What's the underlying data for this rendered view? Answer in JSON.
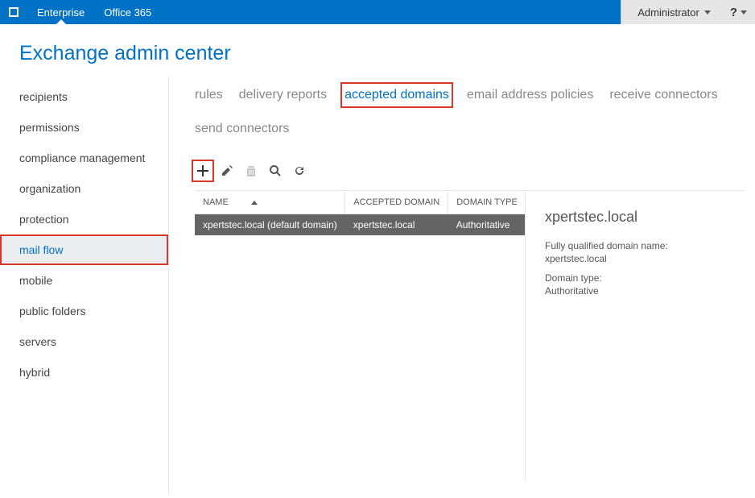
{
  "topbar": {
    "tabs": [
      {
        "label": "Enterprise",
        "active": true
      },
      {
        "label": "Office 365",
        "active": false
      }
    ],
    "user_label": "Administrator",
    "help_label": "?"
  },
  "page_title": "Exchange admin center",
  "sidebar": {
    "items": [
      {
        "label": "recipients"
      },
      {
        "label": "permissions"
      },
      {
        "label": "compliance management"
      },
      {
        "label": "organization"
      },
      {
        "label": "protection"
      },
      {
        "label": "mail flow",
        "active": true,
        "highlighted": true
      },
      {
        "label": "mobile"
      },
      {
        "label": "public folders"
      },
      {
        "label": "servers"
      },
      {
        "label": "hybrid"
      }
    ]
  },
  "tabs": [
    {
      "label": "rules"
    },
    {
      "label": "delivery reports"
    },
    {
      "label": "accepted domains",
      "active": true,
      "highlighted": true
    },
    {
      "label": "email address policies"
    },
    {
      "label": "receive connectors"
    },
    {
      "label": "send connectors"
    }
  ],
  "toolbar": {
    "add": {
      "name": "add-icon",
      "highlighted": true
    },
    "edit": {
      "name": "edit-icon"
    },
    "delete": {
      "name": "delete-icon",
      "disabled": true
    },
    "search": {
      "name": "search-icon"
    },
    "refresh": {
      "name": "refresh-icon"
    }
  },
  "table": {
    "columns": [
      "NAME",
      "ACCEPTED DOMAIN",
      "DOMAIN TYPE"
    ],
    "rows": [
      {
        "name": "xpertstec.local (default domain)",
        "domain": "xpertstec.local",
        "type": "Authoritative",
        "selected": true
      }
    ]
  },
  "detail": {
    "title": "xpertstec.local",
    "fqdn_label": "Fully qualified domain name:",
    "fqdn_value": "xpertstec.local",
    "type_label": "Domain type:",
    "type_value": "Authoritative"
  }
}
